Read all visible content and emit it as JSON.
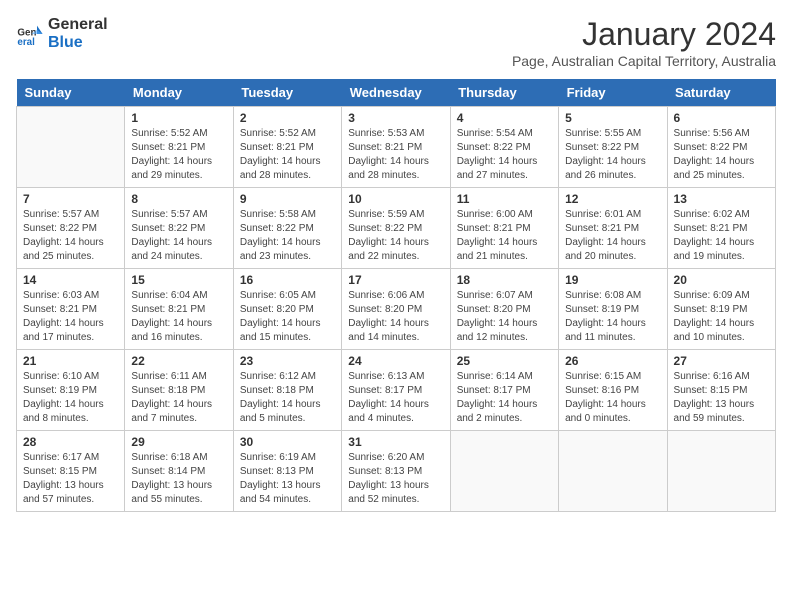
{
  "logo": {
    "line1": "General",
    "line2": "Blue"
  },
  "title": "January 2024",
  "subtitle": "Page, Australian Capital Territory, Australia",
  "days_header": [
    "Sunday",
    "Monday",
    "Tuesday",
    "Wednesday",
    "Thursday",
    "Friday",
    "Saturday"
  ],
  "weeks": [
    [
      {
        "day": "",
        "info": ""
      },
      {
        "day": "1",
        "info": "Sunrise: 5:52 AM\nSunset: 8:21 PM\nDaylight: 14 hours and 29 minutes."
      },
      {
        "day": "2",
        "info": "Sunrise: 5:52 AM\nSunset: 8:21 PM\nDaylight: 14 hours and 28 minutes."
      },
      {
        "day": "3",
        "info": "Sunrise: 5:53 AM\nSunset: 8:21 PM\nDaylight: 14 hours and 28 minutes."
      },
      {
        "day": "4",
        "info": "Sunrise: 5:54 AM\nSunset: 8:22 PM\nDaylight: 14 hours and 27 minutes."
      },
      {
        "day": "5",
        "info": "Sunrise: 5:55 AM\nSunset: 8:22 PM\nDaylight: 14 hours and 26 minutes."
      },
      {
        "day": "6",
        "info": "Sunrise: 5:56 AM\nSunset: 8:22 PM\nDaylight: 14 hours and 25 minutes."
      }
    ],
    [
      {
        "day": "7",
        "info": "Sunrise: 5:57 AM\nSunset: 8:22 PM\nDaylight: 14 hours and 25 minutes."
      },
      {
        "day": "8",
        "info": "Sunrise: 5:57 AM\nSunset: 8:22 PM\nDaylight: 14 hours and 24 minutes."
      },
      {
        "day": "9",
        "info": "Sunrise: 5:58 AM\nSunset: 8:22 PM\nDaylight: 14 hours and 23 minutes."
      },
      {
        "day": "10",
        "info": "Sunrise: 5:59 AM\nSunset: 8:22 PM\nDaylight: 14 hours and 22 minutes."
      },
      {
        "day": "11",
        "info": "Sunrise: 6:00 AM\nSunset: 8:21 PM\nDaylight: 14 hours and 21 minutes."
      },
      {
        "day": "12",
        "info": "Sunrise: 6:01 AM\nSunset: 8:21 PM\nDaylight: 14 hours and 20 minutes."
      },
      {
        "day": "13",
        "info": "Sunrise: 6:02 AM\nSunset: 8:21 PM\nDaylight: 14 hours and 19 minutes."
      }
    ],
    [
      {
        "day": "14",
        "info": "Sunrise: 6:03 AM\nSunset: 8:21 PM\nDaylight: 14 hours and 17 minutes."
      },
      {
        "day": "15",
        "info": "Sunrise: 6:04 AM\nSunset: 8:21 PM\nDaylight: 14 hours and 16 minutes."
      },
      {
        "day": "16",
        "info": "Sunrise: 6:05 AM\nSunset: 8:20 PM\nDaylight: 14 hours and 15 minutes."
      },
      {
        "day": "17",
        "info": "Sunrise: 6:06 AM\nSunset: 8:20 PM\nDaylight: 14 hours and 14 minutes."
      },
      {
        "day": "18",
        "info": "Sunrise: 6:07 AM\nSunset: 8:20 PM\nDaylight: 14 hours and 12 minutes."
      },
      {
        "day": "19",
        "info": "Sunrise: 6:08 AM\nSunset: 8:19 PM\nDaylight: 14 hours and 11 minutes."
      },
      {
        "day": "20",
        "info": "Sunrise: 6:09 AM\nSunset: 8:19 PM\nDaylight: 14 hours and 10 minutes."
      }
    ],
    [
      {
        "day": "21",
        "info": "Sunrise: 6:10 AM\nSunset: 8:19 PM\nDaylight: 14 hours and 8 minutes."
      },
      {
        "day": "22",
        "info": "Sunrise: 6:11 AM\nSunset: 8:18 PM\nDaylight: 14 hours and 7 minutes."
      },
      {
        "day": "23",
        "info": "Sunrise: 6:12 AM\nSunset: 8:18 PM\nDaylight: 14 hours and 5 minutes."
      },
      {
        "day": "24",
        "info": "Sunrise: 6:13 AM\nSunset: 8:17 PM\nDaylight: 14 hours and 4 minutes."
      },
      {
        "day": "25",
        "info": "Sunrise: 6:14 AM\nSunset: 8:17 PM\nDaylight: 14 hours and 2 minutes."
      },
      {
        "day": "26",
        "info": "Sunrise: 6:15 AM\nSunset: 8:16 PM\nDaylight: 14 hours and 0 minutes."
      },
      {
        "day": "27",
        "info": "Sunrise: 6:16 AM\nSunset: 8:15 PM\nDaylight: 13 hours and 59 minutes."
      }
    ],
    [
      {
        "day": "28",
        "info": "Sunrise: 6:17 AM\nSunset: 8:15 PM\nDaylight: 13 hours and 57 minutes."
      },
      {
        "day": "29",
        "info": "Sunrise: 6:18 AM\nSunset: 8:14 PM\nDaylight: 13 hours and 55 minutes."
      },
      {
        "day": "30",
        "info": "Sunrise: 6:19 AM\nSunset: 8:13 PM\nDaylight: 13 hours and 54 minutes."
      },
      {
        "day": "31",
        "info": "Sunrise: 6:20 AM\nSunset: 8:13 PM\nDaylight: 13 hours and 52 minutes."
      },
      {
        "day": "",
        "info": ""
      },
      {
        "day": "",
        "info": ""
      },
      {
        "day": "",
        "info": ""
      }
    ]
  ]
}
